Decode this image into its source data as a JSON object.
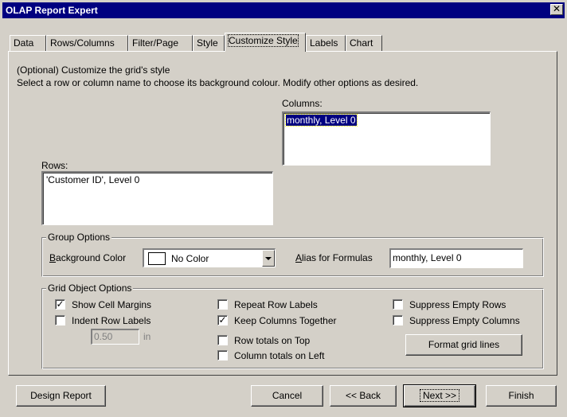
{
  "window": {
    "title": "OLAP Report Expert",
    "close_glyph": "✕"
  },
  "tabs": [
    {
      "label": "Data"
    },
    {
      "label": "Rows/Columns"
    },
    {
      "label": "Filter/Page"
    },
    {
      "label": "Style"
    },
    {
      "label": "Customize Style"
    },
    {
      "label": "Labels"
    },
    {
      "label": "Chart"
    }
  ],
  "active_tab": "Customize Style",
  "intro": {
    "line1": "(Optional) Customize the grid's style",
    "line2": "Select a row or column name to choose its background colour.  Modify other options as desired."
  },
  "columns": {
    "label": "Columns:",
    "items": [
      "monthly, Level 0"
    ],
    "selected": 0
  },
  "rows": {
    "label": "Rows:",
    "items": [
      "'Customer ID', Level 0"
    ]
  },
  "group_options": {
    "legend": "Group Options",
    "bg_color_label": "Background Color",
    "bg_color_value": "No Color",
    "alias_label": "Alias for Formulas",
    "alias_value": "monthly, Level 0"
  },
  "grid_object_options": {
    "legend": "Grid Object Options",
    "show_cell_margins": {
      "label": "Show Cell Margins",
      "checked": true,
      "check_glyph": "✓"
    },
    "indent_row_labels": {
      "label": "Indent Row Labels",
      "checked": false
    },
    "indent_value": "0.50",
    "indent_unit": "in",
    "repeat_row_labels": {
      "label": "Repeat Row Labels",
      "checked": false
    },
    "keep_columns_together": {
      "label": "Keep Columns Together",
      "checked": true,
      "check_glyph": "✓"
    },
    "row_totals_on_top": {
      "label": "Row totals on Top",
      "checked": false
    },
    "column_totals_on_left": {
      "label": "Column totals on Left",
      "checked": false
    },
    "suppress_empty_rows": {
      "label": "Suppress Empty Rows",
      "checked": false
    },
    "suppress_empty_columns": {
      "label": "Suppress Empty Columns",
      "checked": false
    },
    "format_grid_lines": "Format grid lines"
  },
  "footer": {
    "design_report": "Design Report",
    "cancel": "Cancel",
    "back": "<< Back",
    "next": "Next >>",
    "finish": "Finish"
  },
  "colors": {
    "titlebar": "#000080",
    "face": "#d4d0c8",
    "selection": "#000080"
  }
}
